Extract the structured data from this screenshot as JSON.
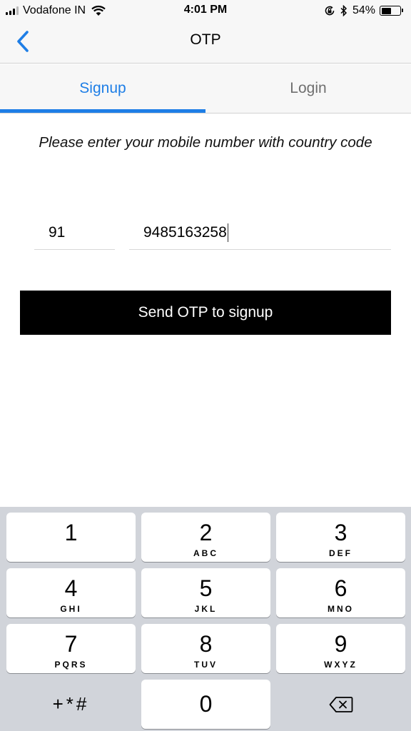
{
  "status_bar": {
    "carrier": "Vodafone IN",
    "time": "4:01 PM",
    "battery_percent": "54%",
    "battery_level": 0.54,
    "signal_bars_filled": 3,
    "signal_bars_total": 4,
    "icons": [
      "signal-icon",
      "wifi-icon",
      "rotation-lock-icon",
      "bluetooth-icon",
      "battery-icon"
    ]
  },
  "nav": {
    "title": "OTP",
    "back_icon": "chevron-left-icon",
    "accent_color": "#1e7ee6"
  },
  "tabs": [
    {
      "label": "Signup",
      "active": true
    },
    {
      "label": "Login",
      "active": false
    }
  ],
  "form": {
    "instruction": "Please enter your mobile number with country code",
    "country_code": "91",
    "phone_number": "9485163258",
    "submit_label": "Send OTP to signup"
  },
  "keypad": {
    "keys": [
      {
        "digit": "1",
        "letters": ""
      },
      {
        "digit": "2",
        "letters": "ABC"
      },
      {
        "digit": "3",
        "letters": "DEF"
      },
      {
        "digit": "4",
        "letters": "GHI"
      },
      {
        "digit": "5",
        "letters": "JKL"
      },
      {
        "digit": "6",
        "letters": "MNO"
      },
      {
        "digit": "7",
        "letters": "PQRS"
      },
      {
        "digit": "8",
        "letters": "TUV"
      },
      {
        "digit": "9",
        "letters": "WXYZ"
      }
    ],
    "symbols": "+*#",
    "zero": "0",
    "delete_icon": "backspace-icon"
  }
}
